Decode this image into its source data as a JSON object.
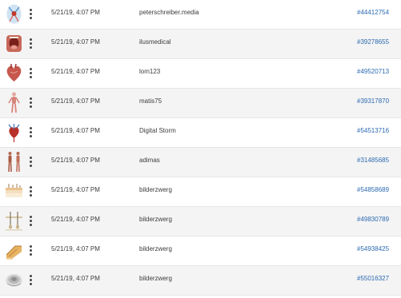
{
  "rows": [
    {
      "icon": "heart-circulatory-illustration",
      "date": "5/21/19, 4:07 PM",
      "author": "peterschreiber.media",
      "id": "#44412754"
    },
    {
      "icon": "mouth-throat-illustration",
      "date": "5/21/19, 4:07 PM",
      "author": "ilusmedical",
      "id": "#39278655"
    },
    {
      "icon": "heart-organ-illustration",
      "date": "5/21/19, 4:07 PM",
      "author": "lom123",
      "id": "#49520713"
    },
    {
      "icon": "human-body-anatomy-illustration",
      "date": "5/21/19, 4:07 PM",
      "author": "matis75",
      "id": "#39317870"
    },
    {
      "icon": "heart-vessels-illustration",
      "date": "5/21/19, 4:07 PM",
      "author": "Digital Storm",
      "id": "#54513716"
    },
    {
      "icon": "body-muscles-illustration",
      "date": "5/21/19, 4:07 PM",
      "author": "adimas",
      "id": "#31485685"
    },
    {
      "icon": "skin-layers-illustration",
      "date": "5/21/19, 4:07 PM",
      "author": "bilderzwerg",
      "id": "#54858689"
    },
    {
      "icon": "hair-follicle-illustration",
      "date": "5/21/19, 4:07 PM",
      "author": "bilderzwerg",
      "id": "#49830789"
    },
    {
      "icon": "skin-cross-section-illustration",
      "date": "5/21/19, 4:07 PM",
      "author": "bilderzwerg",
      "id": "#54938425"
    },
    {
      "icon": "skin-sample-illustration",
      "date": "5/21/19, 4:07 PM",
      "author": "bilderzwerg",
      "id": "#55016327"
    }
  ],
  "colors": {
    "link": "#2c6ab1",
    "text": "#3c3c3c",
    "row_alt": "#f4f4f4",
    "divider": "#e6e6e6"
  }
}
